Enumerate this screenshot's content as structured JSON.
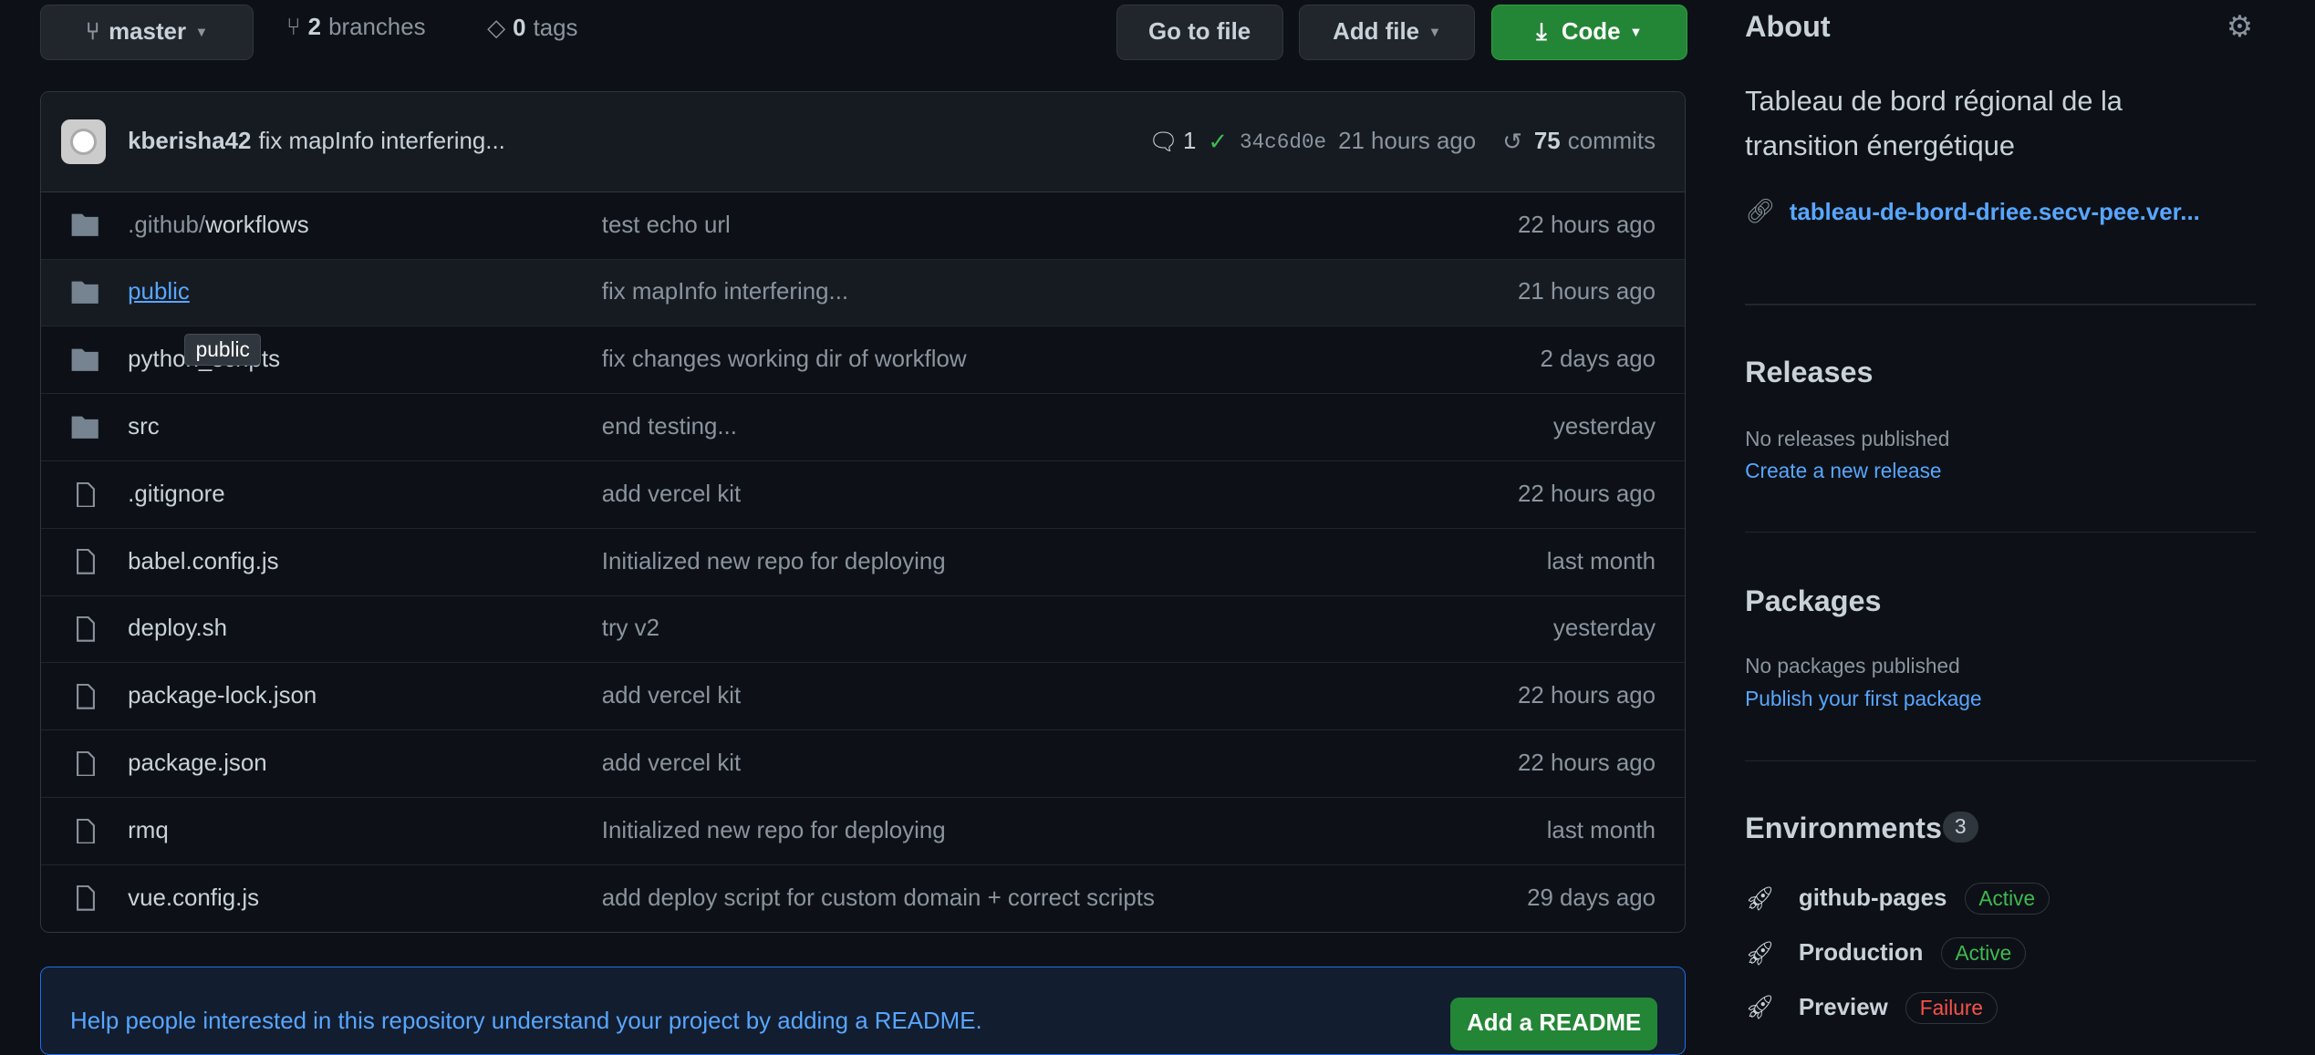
{
  "branch": {
    "name": "master",
    "branches_count": "2",
    "branches_label": "branches",
    "tags_count": "0",
    "tags_label": "tags"
  },
  "buttons": {
    "go_to_file": "Go to file",
    "add_file": "Add file",
    "code": "Code"
  },
  "commit": {
    "author": "kberisha42",
    "message": "fix mapInfo interfering...",
    "comments": "1",
    "sha": "34c6d0e",
    "time": "21 hours ago",
    "commits_count": "75",
    "commits_label": "commits"
  },
  "files": [
    {
      "type": "dir",
      "prefix": ".github/",
      "name": "workflows",
      "message": "test echo url",
      "time": "22 hours ago"
    },
    {
      "type": "dir",
      "prefix": "",
      "name": "public",
      "message": "fix mapInfo interfering...",
      "time": "21 hours ago"
    },
    {
      "type": "dir",
      "prefix": "",
      "name": "python_scripts",
      "message": "fix changes working dir of workflow",
      "time": "2 days ago"
    },
    {
      "type": "dir",
      "prefix": "",
      "name": "src",
      "message": "end testing...",
      "time": "yesterday"
    },
    {
      "type": "file",
      "prefix": "",
      "name": ".gitignore",
      "message": "add vercel kit",
      "time": "22 hours ago"
    },
    {
      "type": "file",
      "prefix": "",
      "name": "babel.config.js",
      "message": "Initialized new repo for deploying",
      "time": "last month"
    },
    {
      "type": "file",
      "prefix": "",
      "name": "deploy.sh",
      "message": "try v2",
      "time": "yesterday"
    },
    {
      "type": "file",
      "prefix": "",
      "name": "package-lock.json",
      "message": "add vercel kit",
      "time": "22 hours ago"
    },
    {
      "type": "file",
      "prefix": "",
      "name": "package.json",
      "message": "add vercel kit",
      "time": "22 hours ago"
    },
    {
      "type": "file",
      "prefix": "",
      "name": "rmq",
      "message": "Initialized new repo for deploying",
      "time": "last month"
    },
    {
      "type": "file",
      "prefix": "",
      "name": "vue.config.js",
      "message": "add deploy script for custom domain + correct scripts",
      "time": "29 days ago"
    }
  ],
  "tooltip": "public",
  "readme": {
    "text": "Help people interested in this repository understand your project by adding a README.",
    "button": "Add a README"
  },
  "about": {
    "title": "About",
    "description": "Tableau de bord régional de la transition énergétique",
    "link": "tableau-de-bord-driee.secv-pee.ver..."
  },
  "releases": {
    "title": "Releases",
    "empty": "No releases published",
    "action": "Create a new release"
  },
  "packages": {
    "title": "Packages",
    "empty": "No packages published",
    "action": "Publish your first package"
  },
  "environments": {
    "title": "Environments",
    "count": "3",
    "items": [
      {
        "name": "github-pages",
        "status": "Active"
      },
      {
        "name": "Production",
        "status": "Active"
      },
      {
        "name": "Preview",
        "status": "Failure"
      }
    ]
  },
  "colors": {
    "bg": "#0d1117",
    "accent": "#58a6ff",
    "green": "#238636",
    "active": "#3fb950",
    "failure": "#f85149"
  }
}
